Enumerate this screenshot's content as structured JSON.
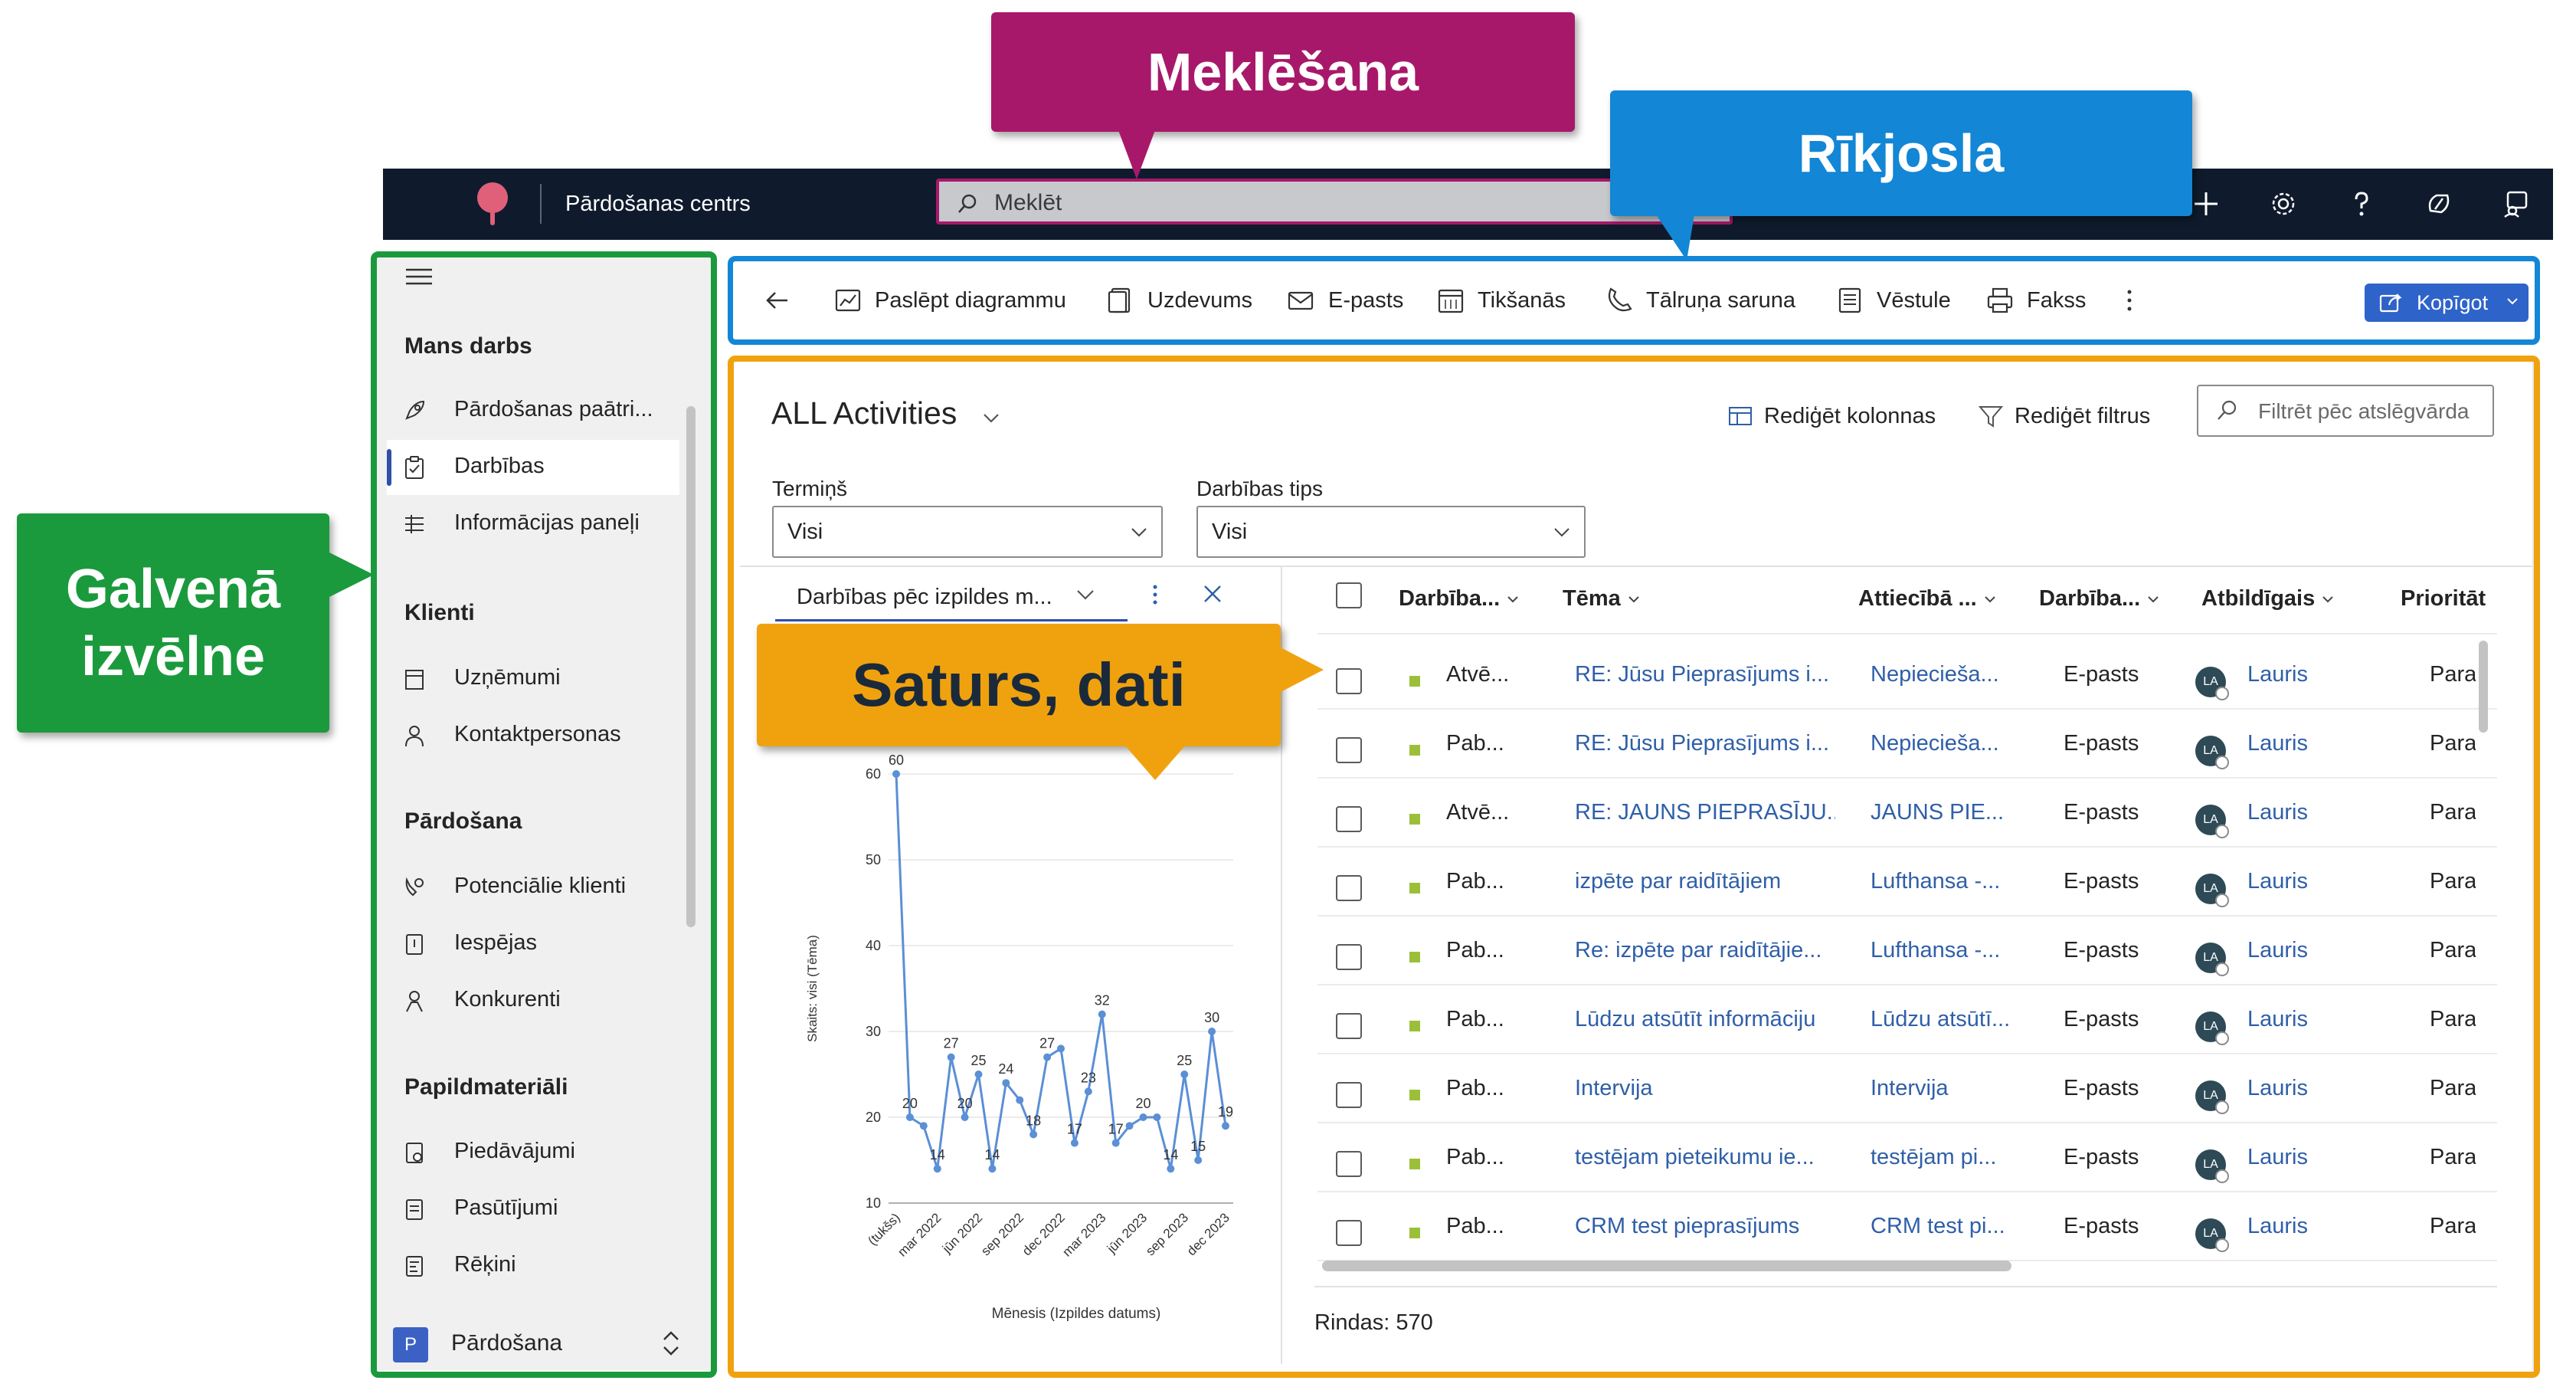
{
  "app": {
    "title": "Pārdošanas centrs"
  },
  "search": {
    "placeholder": "Meklēt"
  },
  "sidebar": {
    "groups": [
      {
        "title": "Mans darbs",
        "items": [
          {
            "label": "Pārdošanas paātri..."
          },
          {
            "label": "Darbības"
          },
          {
            "label": "Informācijas paneļi"
          }
        ]
      },
      {
        "title": "Klienti",
        "items": [
          {
            "label": "Uzņēmumi"
          },
          {
            "label": "Kontaktpersonas"
          }
        ]
      },
      {
        "title": "Pārdošana",
        "items": [
          {
            "label": "Potenciālie klienti"
          },
          {
            "label": "Iespējas"
          },
          {
            "label": "Konkurenti"
          }
        ]
      },
      {
        "title": "Papildmateriāli",
        "items": [
          {
            "label": "Piedāvājumi"
          },
          {
            "label": "Pasūtījumi"
          },
          {
            "label": "Rēķini"
          }
        ]
      }
    ],
    "area_badge": "P",
    "area_label": "Pārdošana"
  },
  "toolbar": {
    "items": [
      {
        "label": "Paslēpt diagrammu",
        "icon": "chart-icon"
      },
      {
        "label": "Uzdevums",
        "icon": "task-icon"
      },
      {
        "label": "E-pasts",
        "icon": "email-icon"
      },
      {
        "label": "Tikšanās",
        "icon": "calendar-icon"
      },
      {
        "label": "Tālruņa saruna",
        "icon": "phone-icon"
      },
      {
        "label": "Vēstule",
        "icon": "letter-icon"
      },
      {
        "label": "Fakss",
        "icon": "fax-icon"
      }
    ],
    "share_label": "Kopīgot"
  },
  "view": {
    "title": "ALL Activities",
    "edit_columns": "Rediģēt kolonnas",
    "edit_filters": "Rediģēt filtrus",
    "filter_placeholder": "Filtrēt pēc atslēgvārda",
    "filters": [
      {
        "label": "Termiņš",
        "value": "Visi"
      },
      {
        "label": "Darbības tips",
        "value": "Visi"
      }
    ]
  },
  "chart_data": {
    "type": "line",
    "title": "Darbības pēc izpildes m...",
    "xlabel": "Mēnesis (Izpildes datums)",
    "ylabel": "Skaits: visi (Tēma)",
    "ylim": [
      10,
      60
    ],
    "yticks": [
      10,
      20,
      30,
      40,
      50,
      60
    ],
    "xtick_labels": [
      "(tukšs)",
      "mar 2022",
      "jūn 2022",
      "sep 2022",
      "dec 2022",
      "mar 2023",
      "jūn 2023",
      "sep 2023",
      "dec 2023"
    ],
    "values": [
      60,
      20,
      19,
      14,
      27,
      20,
      25,
      14,
      24,
      22,
      18,
      27,
      28,
      17,
      23,
      32,
      17,
      19,
      20,
      20,
      14,
      25,
      15,
      30,
      19
    ],
    "data_labels": [
      60,
      20,
      null,
      14,
      27,
      20,
      25,
      14,
      24,
      null,
      18,
      27,
      null,
      17,
      23,
      32,
      17,
      null,
      20,
      null,
      14,
      25,
      15,
      30,
      19
    ],
    "color": "#5b8fd6",
    "grid": true,
    "legend": "none"
  },
  "grid": {
    "columns": [
      "Darbība...",
      "Tēma",
      "Attiecībā ...",
      "Darbība...",
      "Atbildīgais",
      "Prioritāt"
    ],
    "rows": [
      {
        "status": "Atvē...",
        "subject": "RE: Jūsu Pieprasījums i...",
        "regarding": "Nepieciešа...",
        "type": "E-pasts",
        "owner_initials": "LA",
        "owner": "Lauris",
        "priority": "Para"
      },
      {
        "status": "Pab...",
        "subject": "RE: Jūsu Pieprasījums i...",
        "regarding": "Nepieciešа...",
        "type": "E-pasts",
        "owner_initials": "LA",
        "owner": "Lauris",
        "priority": "Para"
      },
      {
        "status": "Atvē...",
        "subject": "RE: JAUNS PIEPRASĪJU...",
        "regarding": "JAUNS PIE...",
        "type": "E-pasts",
        "owner_initials": "LA",
        "owner": "Lauris",
        "priority": "Para"
      },
      {
        "status": "Pab...",
        "subject": "izpēte par raidītājiem",
        "regarding": "Lufthansa -...",
        "type": "E-pasts",
        "owner_initials": "LA",
        "owner": "Lauris",
        "priority": "Para"
      },
      {
        "status": "Pab...",
        "subject": "Re: izpēte par raidītājie...",
        "regarding": "Lufthansa -...",
        "type": "E-pasts",
        "owner_initials": "LA",
        "owner": "Lauris",
        "priority": "Para"
      },
      {
        "status": "Pab...",
        "subject": "Lūdzu atsūtīt informāciju",
        "regarding": "Lūdzu atsūtī...",
        "type": "E-pasts",
        "owner_initials": "LA",
        "owner": "Lauris",
        "priority": "Para"
      },
      {
        "status": "Pab...",
        "subject": "Intervija",
        "regarding": "Intervija",
        "type": "E-pasts",
        "owner_initials": "LA",
        "owner": "Lauris",
        "priority": "Para"
      },
      {
        "status": "Pab...",
        "subject": "testējam pieteikumu ie...",
        "regarding": "testējam pi...",
        "type": "E-pasts",
        "owner_initials": "LA",
        "owner": "Lauris",
        "priority": "Para"
      },
      {
        "status": "Pab...",
        "subject": "CRM test pieprasījums",
        "regarding": "CRM test pi...",
        "type": "E-pasts",
        "owner_initials": "LA",
        "owner": "Lauris",
        "priority": "Para"
      }
    ],
    "row_count": "Rindas: 570"
  },
  "annotations": {
    "search": "Meklēšana",
    "toolbar": "Rīkjosla",
    "menu": "Galvenā izvēlne",
    "content": "Saturs, dati"
  },
  "colors": {
    "topbar": "#0f1b2d",
    "menu": "#1a9a3c",
    "toolbar": "#1386d6",
    "content": "#f0a20e",
    "search": "#a8186a",
    "accent": "#2e63c9"
  }
}
